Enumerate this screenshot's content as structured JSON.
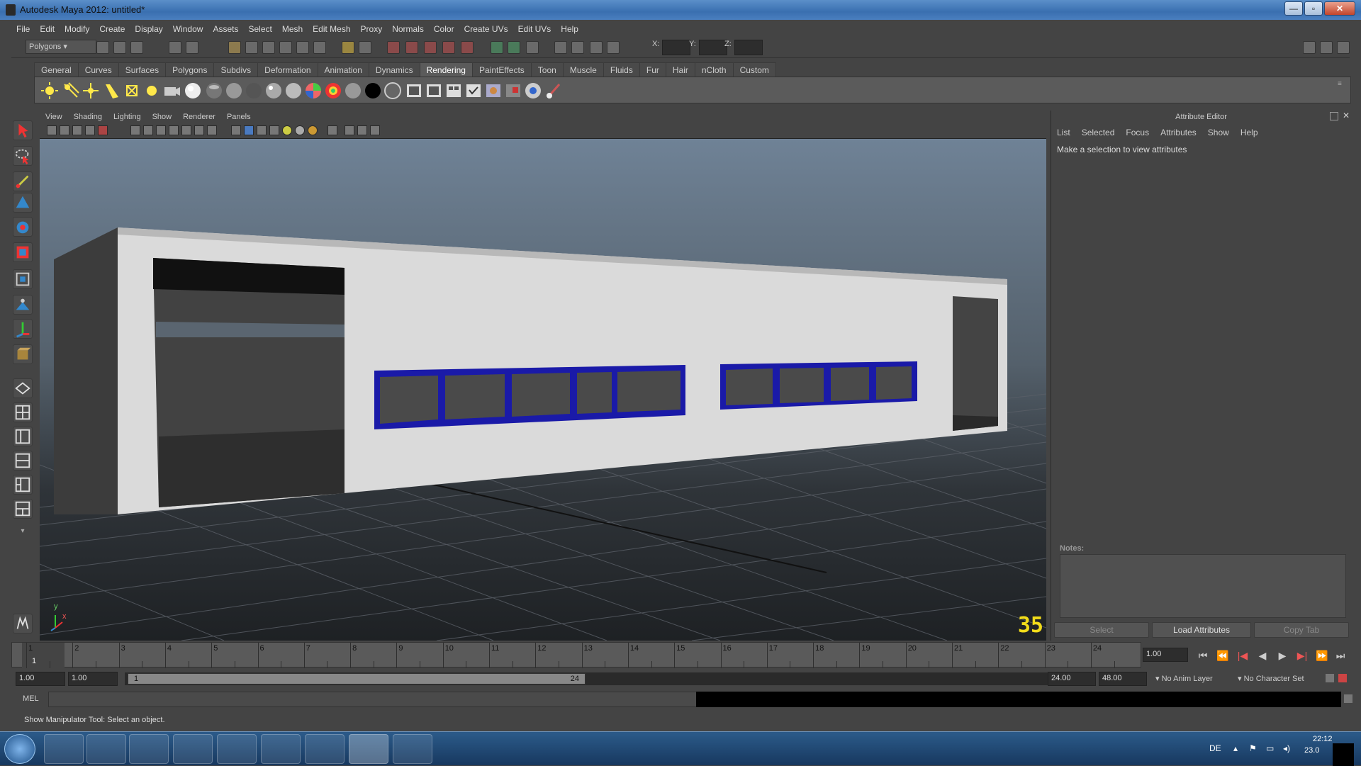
{
  "window": {
    "title": "Autodesk Maya 2012: untitled*"
  },
  "menu": [
    "File",
    "Edit",
    "Modify",
    "Create",
    "Display",
    "Window",
    "Assets",
    "Select",
    "Mesh",
    "Edit Mesh",
    "Proxy",
    "Normals",
    "Color",
    "Create UVs",
    "Edit UVs",
    "Help"
  ],
  "status_line": {
    "menu_set": "Polygons",
    "x_label": "X:",
    "y_label": "Y:",
    "z_label": "Z:"
  },
  "shelf_tabs": [
    "General",
    "Curves",
    "Surfaces",
    "Polygons",
    "Subdivs",
    "Deformation",
    "Animation",
    "Dynamics",
    "Rendering",
    "PaintEffects",
    "Toon",
    "Muscle",
    "Fluids",
    "Fur",
    "Hair",
    "nCloth",
    "Custom"
  ],
  "shelf_active": "Rendering",
  "viewport": {
    "menu": [
      "View",
      "Shading",
      "Lighting",
      "Show",
      "Renderer",
      "Panels"
    ],
    "frame_counter": "35",
    "axis_y": "y",
    "axis_x": "x"
  },
  "attribute_editor": {
    "title": "Attribute Editor",
    "menu": [
      "List",
      "Selected",
      "Focus",
      "Attributes",
      "Show",
      "Help"
    ],
    "message": "Make a selection to view attributes",
    "notes_label": "Notes:",
    "buttons": {
      "select": "Select",
      "load": "Load Attributes",
      "copy": "Copy Tab"
    }
  },
  "timeline": {
    "ticks": [
      "1",
      "2",
      "3",
      "4",
      "5",
      "6",
      "7",
      "8",
      "9",
      "10",
      "11",
      "12",
      "13",
      "14",
      "15",
      "16",
      "17",
      "18",
      "19",
      "20",
      "21",
      "22",
      "23",
      "24"
    ],
    "current_marker": "1",
    "current_frame": "1.00"
  },
  "range_slider": {
    "start_time": "1.00",
    "playback_start": "1.00",
    "range_start": "1",
    "range_end": "24",
    "playback_end": "24.00",
    "end_time": "48.00",
    "anim_layer": "No Anim Layer",
    "character_set": "No Character Set"
  },
  "command_line": {
    "label": "MEL"
  },
  "help_line": "Show Manipulator Tool: Select an object.",
  "taskbar": {
    "language": "DE",
    "time": "22:12",
    "date": "23.0"
  },
  "colors": {
    "window_frame": "#3a6fb0",
    "ui_bg": "#444444",
    "window_frame_blue": "#1a1aa8",
    "wall": "#dadada",
    "frame_counter": "#f2dc1a"
  }
}
